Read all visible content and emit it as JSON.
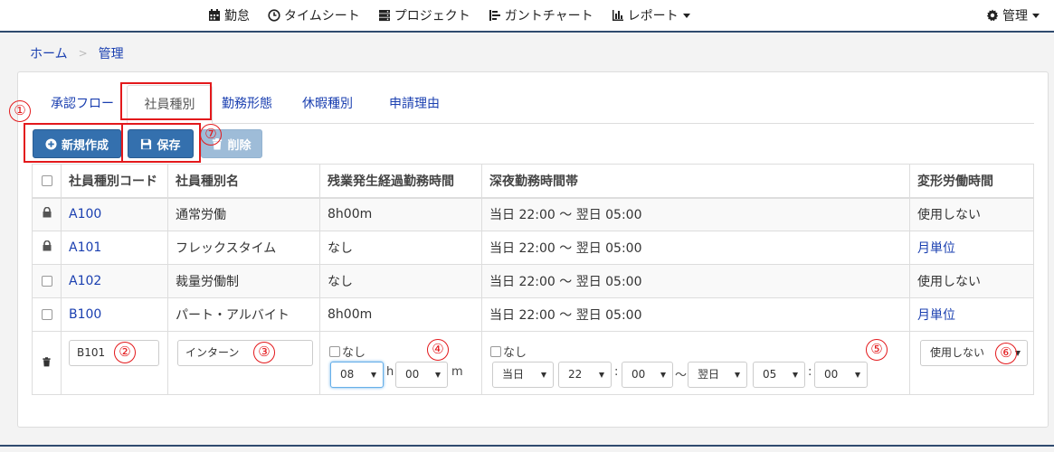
{
  "nav": {
    "items": [
      {
        "label": "勤怠",
        "icon": "calendar-icon"
      },
      {
        "label": "タイムシート",
        "icon": "clock-icon"
      },
      {
        "label": "プロジェクト",
        "icon": "server-icon"
      },
      {
        "label": "ガントチャート",
        "icon": "gantt-icon"
      },
      {
        "label": "レポート",
        "icon": "bar-chart-icon"
      }
    ],
    "admin_label": "管理"
  },
  "breadcrumb": {
    "home": "ホーム",
    "sep": ">",
    "current": "管理"
  },
  "tabs": [
    "承認フロー",
    "社員種別",
    "勤務形態",
    "休暇種別",
    "申請理由"
  ],
  "active_tab": "社員種別",
  "toolbar": {
    "new_label": "新規作成",
    "save_label": "保存",
    "delete_label": "削除"
  },
  "table": {
    "headers": [
      "社員種別コード",
      "社員種別名",
      "残業発生経過勤務時間",
      "深夜勤務時間帯",
      "変形労働時間"
    ],
    "rows": [
      {
        "code": "A100",
        "name": "通常労働",
        "overtime": "8h00m",
        "night": "当日 22:00 〜 翌日 05:00",
        "variable": "使用しない",
        "locked": true,
        "variable_link": false
      },
      {
        "code": "A101",
        "name": "フレックスタイム",
        "overtime": "なし",
        "night": "当日 22:00 〜 翌日 05:00",
        "variable": "月単位",
        "locked": true,
        "variable_link": true
      },
      {
        "code": "A102",
        "name": "裁量労働制",
        "overtime": "なし",
        "night": "当日 22:00 〜 翌日 05:00",
        "variable": "使用しない",
        "locked": false,
        "variable_link": false
      },
      {
        "code": "B100",
        "name": "パート・アルバイト",
        "overtime": "8h00m",
        "night": "当日 22:00 〜 翌日 05:00",
        "variable": "月単位",
        "locked": false,
        "variable_link": true
      }
    ],
    "edit_row": {
      "code_value": "B101",
      "name_value": "インターン",
      "overtime_none_label": "なし",
      "overtime_hours": "08",
      "hours_unit": "h",
      "overtime_minutes": "00",
      "minutes_unit": "m",
      "night_none_label": "なし",
      "night_start_day": "当日",
      "night_start_hour": "22",
      "colon": ":",
      "night_start_min": "00",
      "tilde": "〜",
      "night_end_day": "翌日",
      "night_end_hour": "05",
      "night_end_min": "00",
      "variable_value": "使用しない"
    }
  },
  "annotations": [
    "①",
    "②",
    "③",
    "④",
    "⑤",
    "⑥",
    "⑦"
  ],
  "colors": {
    "primary": "#3470ae",
    "link": "#1a3fb0",
    "highlight": "#e3191c",
    "nav_border": "#2f4a6e"
  }
}
